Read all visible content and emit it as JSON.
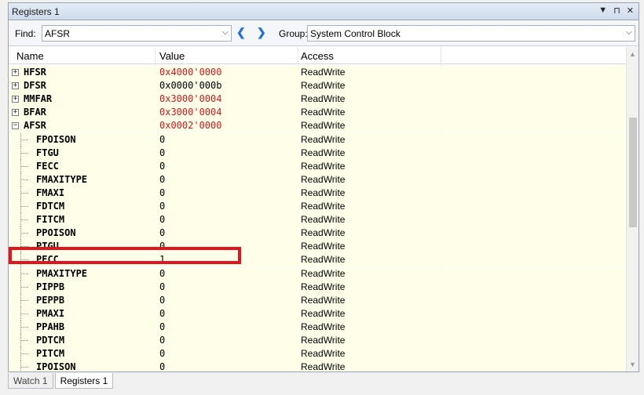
{
  "window": {
    "title": "Registers 1",
    "controls": [
      "▼",
      "⊓",
      "✕"
    ]
  },
  "toolbar": {
    "find_label": "Find:",
    "find_value": "AFSR",
    "group_label": "Group:",
    "group_value": "System Control Block",
    "prev": "❮",
    "next": "❯",
    "dropdown": "⌵"
  },
  "columns": [
    "Name",
    "Value",
    "Access"
  ],
  "rows": [
    {
      "name": "HFSR",
      "value": "0x4000'0000",
      "access": "ReadWrite",
      "red": true,
      "expander": "+"
    },
    {
      "name": "DFSR",
      "value": "0x0000'000b",
      "access": "ReadWrite",
      "red": false,
      "expander": "+"
    },
    {
      "name": "MMFAR",
      "value": "0x3000'0004",
      "access": "ReadWrite",
      "red": true,
      "expander": "+"
    },
    {
      "name": "BFAR",
      "value": "0x3000'0004",
      "access": "ReadWrite",
      "red": true,
      "expander": "+"
    },
    {
      "name": "AFSR",
      "value": "0x0002'0000",
      "access": "ReadWrite",
      "red": true,
      "expander": "−"
    },
    {
      "name": "FPOISON",
      "value": "0",
      "access": "ReadWrite",
      "child": true
    },
    {
      "name": "FTGU",
      "value": "0",
      "access": "ReadWrite",
      "child": true
    },
    {
      "name": "FECC",
      "value": "0",
      "access": "ReadWrite",
      "child": true
    },
    {
      "name": "FMAXITYPE",
      "value": "0",
      "access": "ReadWrite",
      "child": true
    },
    {
      "name": "FMAXI",
      "value": "0",
      "access": "ReadWrite",
      "child": true
    },
    {
      "name": "FDTCM",
      "value": "0",
      "access": "ReadWrite",
      "child": true
    },
    {
      "name": "FITCM",
      "value": "0",
      "access": "ReadWrite",
      "child": true
    },
    {
      "name": "PPOISON",
      "value": "0",
      "access": "ReadWrite",
      "child": true
    },
    {
      "name": "PTGU",
      "value": "0",
      "access": "ReadWrite",
      "child": true
    },
    {
      "name": "PECC",
      "value": "1",
      "access": "ReadWrite",
      "child": true
    },
    {
      "name": "PMAXITYPE",
      "value": "0",
      "access": "ReadWrite",
      "child": true
    },
    {
      "name": "PIPPB",
      "value": "0",
      "access": "ReadWrite",
      "child": true
    },
    {
      "name": "PEPPB",
      "value": "0",
      "access": "ReadWrite",
      "child": true
    },
    {
      "name": "PMAXI",
      "value": "0",
      "access": "ReadWrite",
      "child": true
    },
    {
      "name": "PPAHB",
      "value": "0",
      "access": "ReadWrite",
      "child": true
    },
    {
      "name": "PDTCM",
      "value": "0",
      "access": "ReadWrite",
      "child": true
    },
    {
      "name": "PITCM",
      "value": "0",
      "access": "ReadWrite",
      "child": true
    },
    {
      "name": "IPOISON",
      "value": "0",
      "access": "ReadWrite",
      "child": true
    }
  ],
  "tabs": [
    {
      "label": "Watch 1",
      "active": false
    },
    {
      "label": "Registers 1",
      "active": true
    }
  ],
  "colors": {
    "red_value": "#d01a1a",
    "row_bg": "#fefee9",
    "highlight": "#e0151d"
  }
}
